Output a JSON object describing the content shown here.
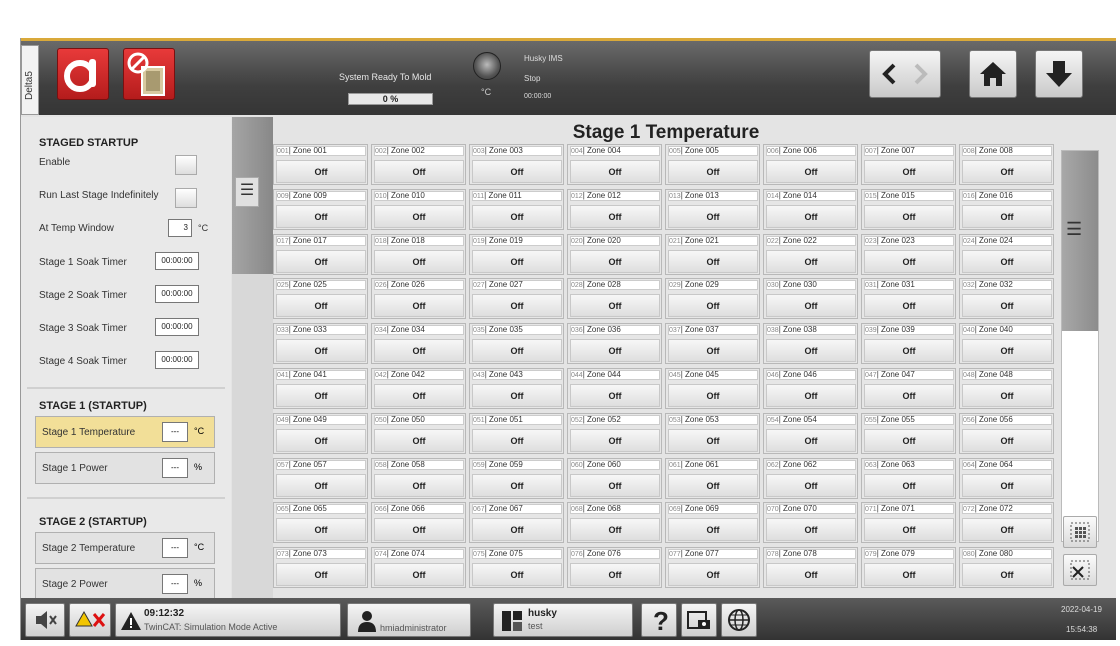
{
  "header": {
    "tab_label": "Delta5",
    "system_status": "System Ready To Mold",
    "progress_text": "0 %",
    "progress_value": 0,
    "degree_unit": "°C",
    "ims_name": "Husky IMS",
    "ims_state": "Stop",
    "ims_time": "00:00:00"
  },
  "staged_startup": {
    "title": "STAGED STARTUP",
    "enable_label": "Enable",
    "run_last_label": "Run Last Stage Indefinitely",
    "at_temp_label": "At Temp Window",
    "at_temp_value": "3",
    "at_temp_unit": "°C",
    "soak_timers": [
      {
        "label": "Stage 1 Soak Timer",
        "value": "00:00:00"
      },
      {
        "label": "Stage 2 Soak Timer",
        "value": "00:00:00"
      },
      {
        "label": "Stage 3 Soak Timer",
        "value": "00:00:00"
      },
      {
        "label": "Stage 4 Soak Timer",
        "value": "00:00:00"
      }
    ]
  },
  "stage1": {
    "title": "STAGE 1 (STARTUP)",
    "temp_label": "Stage 1 Temperature",
    "temp_value": "---",
    "temp_unit": "°C",
    "power_label": "Stage 1 Power",
    "power_value": "---",
    "power_unit": "%"
  },
  "stage2": {
    "title": "STAGE 2 (STARTUP)",
    "temp_label": "Stage 2 Temperature",
    "temp_value": "---",
    "temp_unit": "°C",
    "power_label": "Stage 2 Power",
    "power_value": "---",
    "power_unit": "%"
  },
  "grid": {
    "title": "Stage 1 Temperature",
    "zone_value": "Off",
    "zones": [
      {
        "id": "001",
        "name": "Zone 001"
      },
      {
        "id": "002",
        "name": "Zone 002"
      },
      {
        "id": "003",
        "name": "Zone 003"
      },
      {
        "id": "004",
        "name": "Zone 004"
      },
      {
        "id": "005",
        "name": "Zone 005"
      },
      {
        "id": "006",
        "name": "Zone 006"
      },
      {
        "id": "007",
        "name": "Zone 007"
      },
      {
        "id": "008",
        "name": "Zone 008"
      },
      {
        "id": "009",
        "name": "Zone 009"
      },
      {
        "id": "010",
        "name": "Zone 010"
      },
      {
        "id": "011",
        "name": "Zone 011"
      },
      {
        "id": "012",
        "name": "Zone 012"
      },
      {
        "id": "013",
        "name": "Zone 013"
      },
      {
        "id": "014",
        "name": "Zone 014"
      },
      {
        "id": "015",
        "name": "Zone 015"
      },
      {
        "id": "016",
        "name": "Zone 016"
      },
      {
        "id": "017",
        "name": "Zone 017"
      },
      {
        "id": "018",
        "name": "Zone 018"
      },
      {
        "id": "019",
        "name": "Zone 019"
      },
      {
        "id": "020",
        "name": "Zone 020"
      },
      {
        "id": "021",
        "name": "Zone 021"
      },
      {
        "id": "022",
        "name": "Zone 022"
      },
      {
        "id": "023",
        "name": "Zone 023"
      },
      {
        "id": "024",
        "name": "Zone 024"
      },
      {
        "id": "025",
        "name": "Zone 025"
      },
      {
        "id": "026",
        "name": "Zone 026"
      },
      {
        "id": "027",
        "name": "Zone 027"
      },
      {
        "id": "028",
        "name": "Zone 028"
      },
      {
        "id": "029",
        "name": "Zone 029"
      },
      {
        "id": "030",
        "name": "Zone 030"
      },
      {
        "id": "031",
        "name": "Zone 031"
      },
      {
        "id": "032",
        "name": "Zone 032"
      },
      {
        "id": "033",
        "name": "Zone 033"
      },
      {
        "id": "034",
        "name": "Zone 034"
      },
      {
        "id": "035",
        "name": "Zone 035"
      },
      {
        "id": "036",
        "name": "Zone 036"
      },
      {
        "id": "037",
        "name": "Zone 037"
      },
      {
        "id": "038",
        "name": "Zone 038"
      },
      {
        "id": "039",
        "name": "Zone 039"
      },
      {
        "id": "040",
        "name": "Zone 040"
      },
      {
        "id": "041",
        "name": "Zone 041"
      },
      {
        "id": "042",
        "name": "Zone 042"
      },
      {
        "id": "043",
        "name": "Zone 043"
      },
      {
        "id": "044",
        "name": "Zone 044"
      },
      {
        "id": "045",
        "name": "Zone 045"
      },
      {
        "id": "046",
        "name": "Zone 046"
      },
      {
        "id": "047",
        "name": "Zone 047"
      },
      {
        "id": "048",
        "name": "Zone 048"
      },
      {
        "id": "049",
        "name": "Zone 049"
      },
      {
        "id": "050",
        "name": "Zone 050"
      },
      {
        "id": "051",
        "name": "Zone 051"
      },
      {
        "id": "052",
        "name": "Zone 052"
      },
      {
        "id": "053",
        "name": "Zone 053"
      },
      {
        "id": "054",
        "name": "Zone 054"
      },
      {
        "id": "055",
        "name": "Zone 055"
      },
      {
        "id": "056",
        "name": "Zone 056"
      },
      {
        "id": "057",
        "name": "Zone 057"
      },
      {
        "id": "058",
        "name": "Zone 058"
      },
      {
        "id": "059",
        "name": "Zone 059"
      },
      {
        "id": "060",
        "name": "Zone 060"
      },
      {
        "id": "061",
        "name": "Zone 061"
      },
      {
        "id": "062",
        "name": "Zone 062"
      },
      {
        "id": "063",
        "name": "Zone 063"
      },
      {
        "id": "064",
        "name": "Zone 064"
      },
      {
        "id": "065",
        "name": "Zone 065"
      },
      {
        "id": "066",
        "name": "Zone 066"
      },
      {
        "id": "067",
        "name": "Zone 067"
      },
      {
        "id": "068",
        "name": "Zone 068"
      },
      {
        "id": "069",
        "name": "Zone 069"
      },
      {
        "id": "070",
        "name": "Zone 070"
      },
      {
        "id": "071",
        "name": "Zone 071"
      },
      {
        "id": "072",
        "name": "Zone 072"
      },
      {
        "id": "073",
        "name": "Zone 073"
      },
      {
        "id": "074",
        "name": "Zone 074"
      },
      {
        "id": "075",
        "name": "Zone 075"
      },
      {
        "id": "076",
        "name": "Zone 076"
      },
      {
        "id": "077",
        "name": "Zone 077"
      },
      {
        "id": "078",
        "name": "Zone 078"
      },
      {
        "id": "079",
        "name": "Zone 079"
      },
      {
        "id": "080",
        "name": "Zone 080"
      }
    ]
  },
  "footer": {
    "alarm_time": "09:12:32",
    "alarm_text": "TwinCAT: Simulation Mode Active",
    "user": "hmiadministrator",
    "project_name": "husky",
    "project_sub": "test",
    "date": "2022-04-19",
    "time": "15:54:38"
  },
  "colors": {
    "header_accent": "#d9a93a",
    "alarm_red": "#c0201f",
    "stage_highlight": "#f2df98"
  },
  "icons": {
    "heater": "heater-status-icon",
    "mold": "mold-disabled-icon",
    "back": "chevron-left-icon",
    "forward": "chevron-right-icon",
    "home": "home-icon",
    "down": "arrow-down-icon",
    "mute": "speaker-mute-icon",
    "warning": "warning-icon",
    "user": "user-icon",
    "help": "help-icon",
    "screenshot": "screenshot-icon",
    "language": "globe-icon"
  }
}
